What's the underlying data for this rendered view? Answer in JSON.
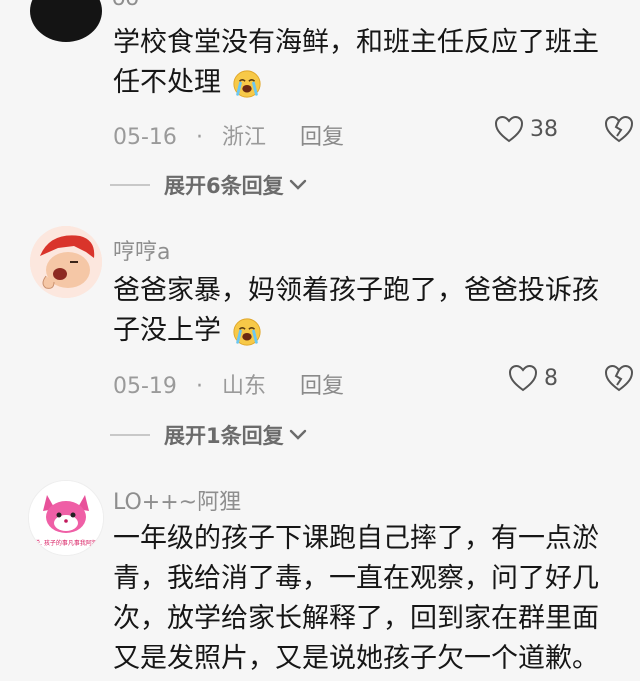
{
  "comments": [
    {
      "lines": [
        "学校食堂没有海鲜，和班主任反应了班主",
        "任不处理"
      ],
      "emoji": "crying-face-emoji",
      "date": "05-16",
      "region": "浙江",
      "reply_label": "回复",
      "likes": "38",
      "expand_label": "展开6条回复"
    },
    {
      "username": "哼哼a",
      "lines": [
        "爸爸家暴，妈领着孩子跑了，爸爸投诉孩",
        "子没上学"
      ],
      "emoji": "crying-face-emoji",
      "date": "05-19",
      "region": "山东",
      "reply_label": "回复",
      "likes": "8",
      "expand_label": "展开1条回复"
    },
    {
      "username": "LO++~阿狸",
      "lines": [
        "一年级的孩子下课跑自己摔了，有一点淤",
        "青，我给消了毒，一直在观察，问了好几",
        "次，放学给家长解释了，回到家在群里面",
        "又是发照片，又是说她孩子欠一个道歉。"
      ]
    }
  ],
  "separator": "·",
  "colors": {
    "background": "#f6f6f6",
    "text": "#161616",
    "muted": "#9a9a9a",
    "emoji_yellow": "#f7c948"
  },
  "icons": {
    "like": "heart-icon",
    "dislike": "broken-heart-icon",
    "expand": "chevron-down-icon"
  }
}
